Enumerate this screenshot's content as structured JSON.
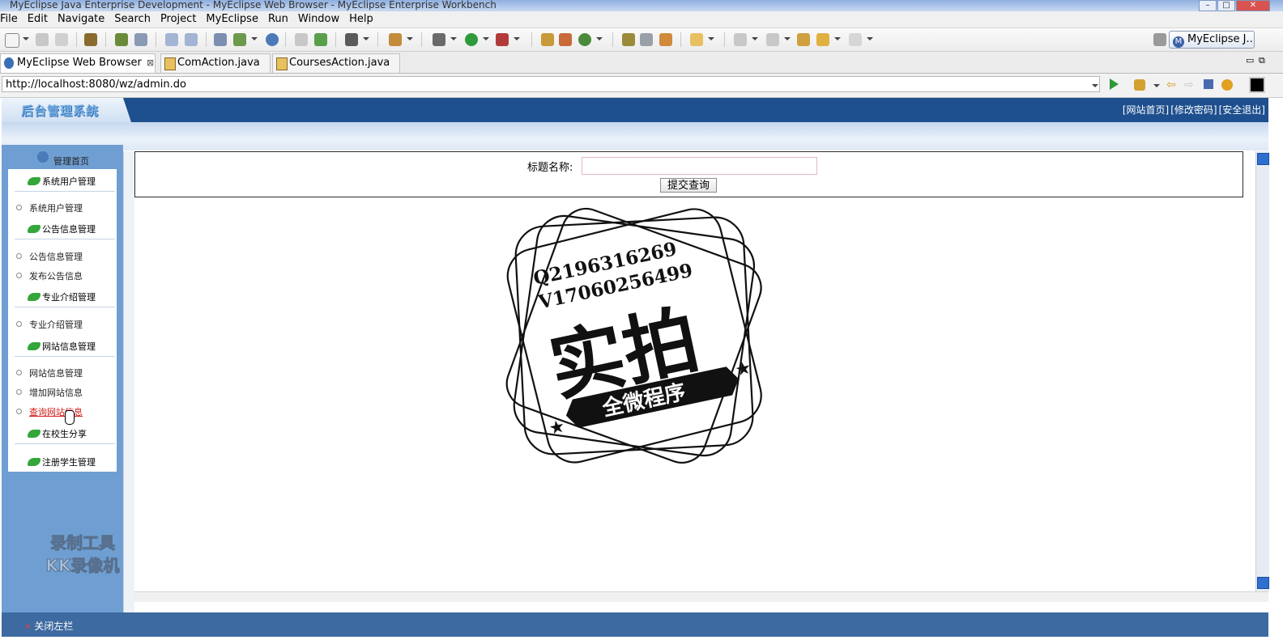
{
  "window": {
    "title": "MyEclipse Java Enterprise Development - MyEclipse Web Browser - MyEclipse Enterprise Workbench"
  },
  "menu": [
    "File",
    "Edit",
    "Navigate",
    "Search",
    "Project",
    "MyEclipse",
    "Run",
    "Window",
    "Help"
  ],
  "perspective": {
    "label": "MyEclipse J..."
  },
  "tabs": [
    {
      "label": "MyEclipse Web Browser",
      "close": "⊠"
    },
    {
      "label": "ComAction.java"
    },
    {
      "label": "CoursesAction.java"
    }
  ],
  "address": {
    "url": "http://localhost:8080/wz/admin.do"
  },
  "site": {
    "logo": "后台管理系统",
    "links": [
      "[网站首页]",
      "[修改密码]",
      "[安全退出]"
    ]
  },
  "sidebar": {
    "home": "管理首页",
    "cats": [
      "系统用户管理",
      "公告信息管理",
      "专业介绍管理",
      "网站信息管理",
      "在校生分享",
      "注册学生管理"
    ],
    "items": [
      "系统用户管理",
      "公告信息管理",
      "发布公告信息",
      "专业介绍管理",
      "网站信息管理",
      "增加网站信息",
      "查询网站信息"
    ],
    "watermark": [
      "录制工具",
      "KK录像机"
    ]
  },
  "search": {
    "label": "标题名称:",
    "value": "",
    "button": "提交查询"
  },
  "footer": {
    "label": "关闭左栏"
  },
  "stamp": {
    "line1": "Q2196316269",
    "line2": "V17060256499",
    "big": "实拍",
    "ribbon": "全微程序"
  }
}
